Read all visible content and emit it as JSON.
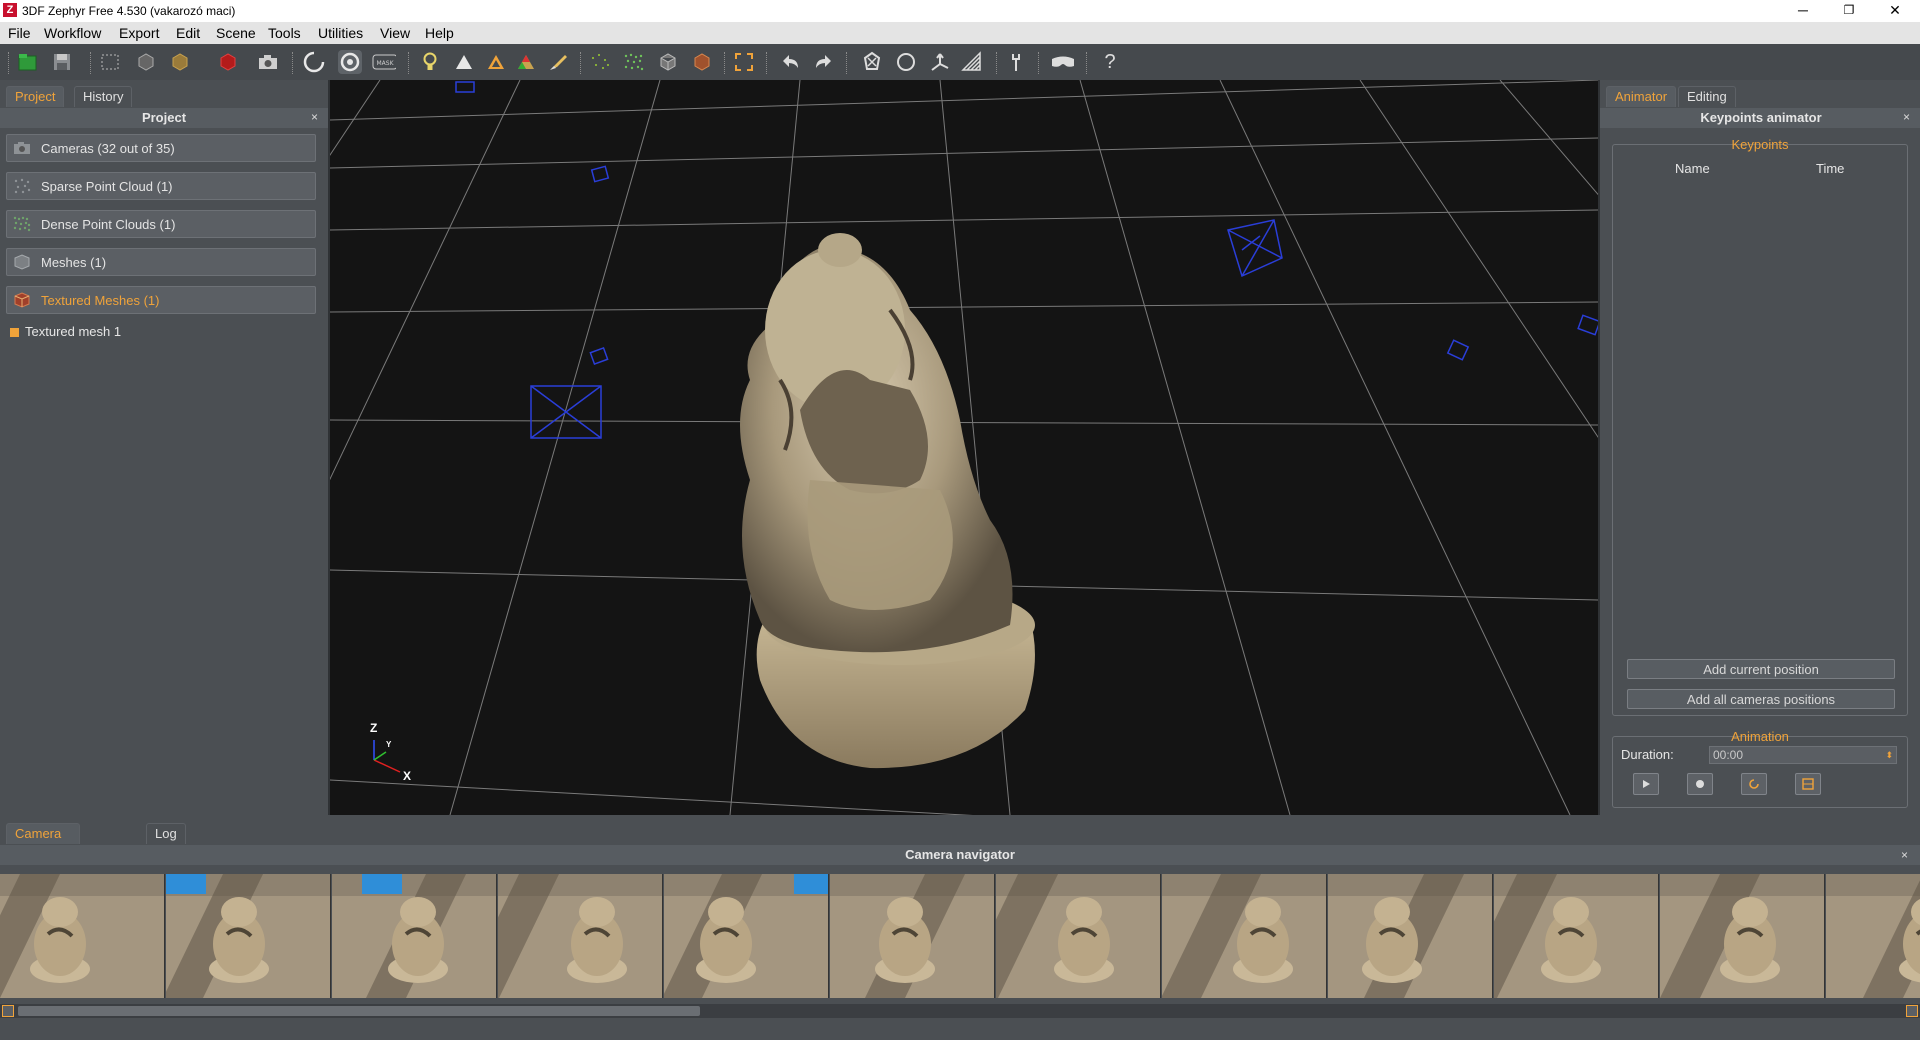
{
  "window": {
    "title": "3DF Zephyr Free 4.530 (vakarozó maci)",
    "icon_letter": "Z",
    "minimize": "─",
    "restore": "❐",
    "close": "✕"
  },
  "menu": [
    "File",
    "Workflow",
    "Export",
    "Edit",
    "Scene",
    "Tools",
    "Utilities",
    "View",
    "Help"
  ],
  "toolbar": {
    "icons": [
      "new-project-icon",
      "save-icon",
      "select-rect-icon",
      "box-icon",
      "cube-icon",
      "textured-cube-icon",
      "camera-icon",
      "rotate-icon",
      "orbit-icon",
      "mask-icon",
      "light-icon",
      "triangle-icon",
      "color-triangle-icon",
      "rgb-triangle-icon",
      "brush-icon",
      "sparse-points-icon",
      "dense-points-icon",
      "mesh-icon",
      "textured-mesh-icon",
      "frame-icon",
      "undo-icon",
      "redo-icon",
      "polygon-select-icon",
      "lasso-icon",
      "gizmo-icon",
      "wireframe-icon",
      "tool-icon",
      "vr-icon",
      "help-icon"
    ],
    "mask_text": "MASK",
    "help_text": "?"
  },
  "left_panel": {
    "tabs": [
      "Project",
      "History"
    ],
    "active_tab": "Project",
    "title": "Project",
    "close": "×",
    "items": [
      {
        "label": "Cameras (32 out of 35)",
        "icon": "camera-icon"
      },
      {
        "label": "Sparse Point Cloud (1)",
        "icon": "sparse-cloud-icon"
      },
      {
        "label": "Dense Point Clouds (1)",
        "icon": "dense-cloud-icon"
      },
      {
        "label": "Meshes (1)",
        "icon": "mesh-icon"
      },
      {
        "label": "Textured Meshes (1)",
        "icon": "textured-mesh-icon"
      }
    ],
    "active_item": "Textured Meshes (1)",
    "subitem": "Textured mesh 1"
  },
  "viewport": {
    "axis_labels": {
      "z": "Z",
      "y": "Y",
      "x": "X"
    },
    "grid_color": "#8c8c8c",
    "camera_frustum_color": "#2236c8"
  },
  "right_panel": {
    "tabs": [
      "Animator",
      "Editing"
    ],
    "active_tab": "Animator",
    "title": "Keypoints animator",
    "close": "×",
    "keypoints": {
      "group_title": "Keypoints",
      "columns": [
        "Name",
        "Time"
      ],
      "rows": []
    },
    "buttons": [
      "Add current position",
      "Add all cameras positions"
    ],
    "animation": {
      "group_title": "Animation",
      "duration_label": "Duration:",
      "duration_value": "00:00",
      "controls": [
        "play-icon",
        "record-icon",
        "loop-icon",
        "export-video-icon"
      ]
    }
  },
  "bottom_panel": {
    "tabs": [
      "Camera Navigator",
      "Log"
    ],
    "active_tab": "Camera Navigator",
    "title": "Camera navigator",
    "close": "×",
    "thumbnail_count": 12
  },
  "colors": {
    "accent": "#f0a33a",
    "panel_bg": "#4b4f53",
    "viewport_bg": "#141414"
  }
}
